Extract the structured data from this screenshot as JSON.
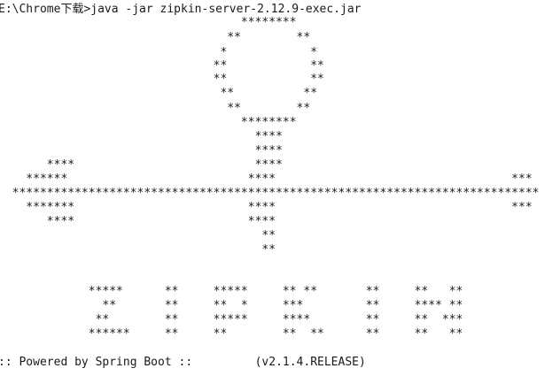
{
  "console": {
    "lines": [
      "E:\\Chrome下载>java -jar zipkin-server-2.12.9-exec.jar",
      "                                   ********",
      "                                 **        **",
      "                                *            *",
      "                               **            **",
      "                               **            **",
      "                                **          **",
      "                                 **        **",
      "                                   ********",
      "                                     ****",
      "                                     ****",
      "       ****                          ****",
      "    ******                          ****                                  ***",
      "  ****************************************************************************",
      "    *******                         ****                                  ***",
      "       ****                         ****",
      "                                      **",
      "                                      **",
      "",
      "",
      "             *****      **     *****     ** **       **     **   **",
      "               **       **     **  *     ***         **     **** **",
      "              **        **     *****     ****        **     **  ***",
      "             ******     **     **        **  **      **     **   **",
      "",
      ":: Powered by Spring Boot ::         (v2.1.4.RELEASE)"
    ]
  }
}
